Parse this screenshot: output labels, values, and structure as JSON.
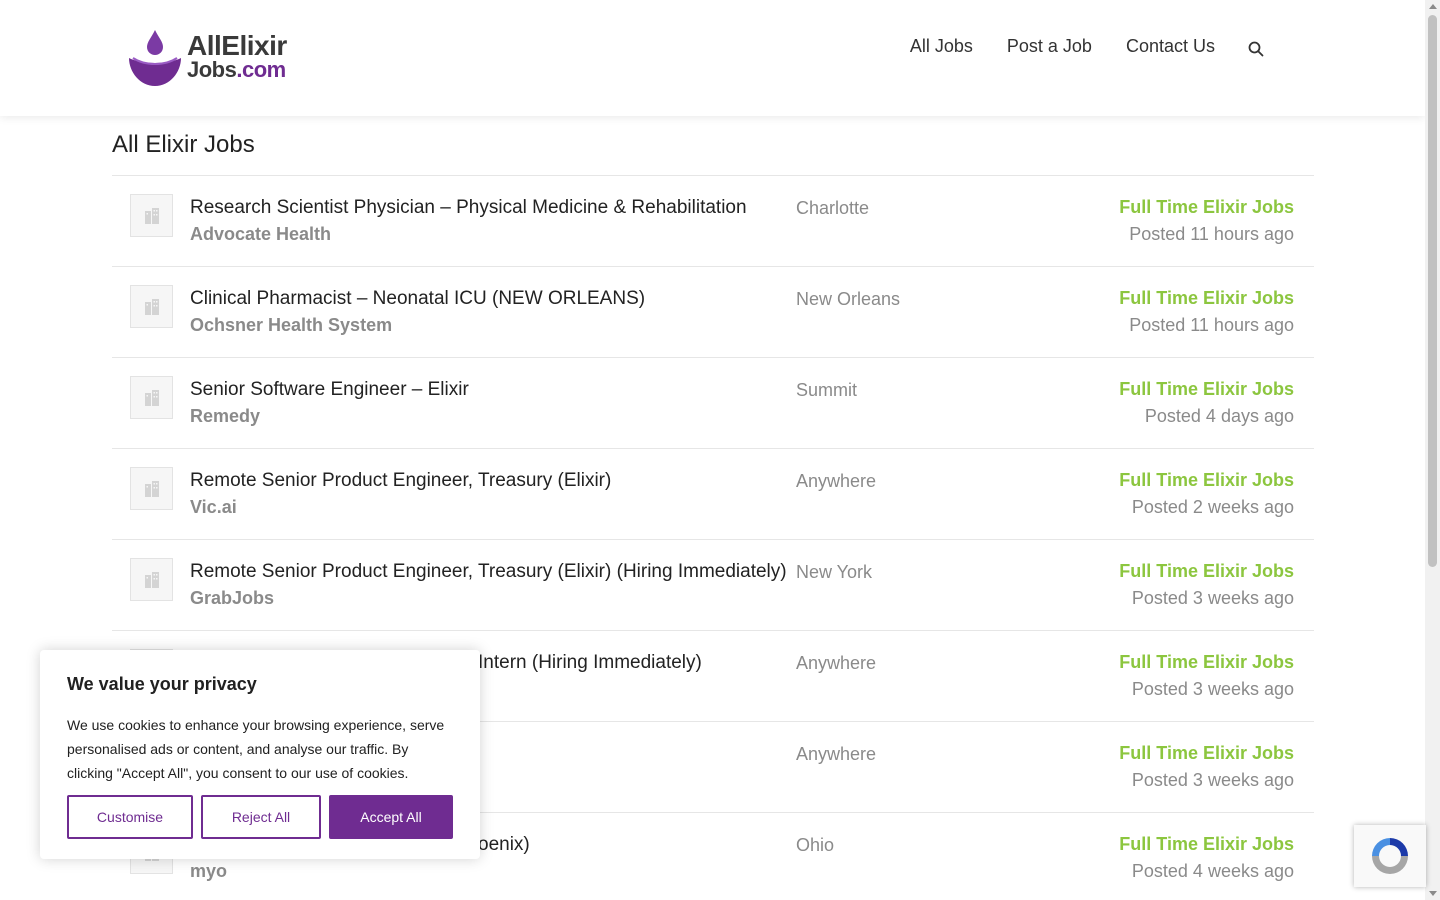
{
  "logo": {
    "line1": "AllElixir",
    "line2_main": "Jobs",
    "line2_suffix": ".com"
  },
  "nav": {
    "items": [
      "All Jobs",
      "Post a Job",
      "Contact Us"
    ],
    "search_icon": "search-icon"
  },
  "page": {
    "title": "All Elixir Jobs"
  },
  "jobs": [
    {
      "title": "Research Scientist Physician – Physical Medicine & Rehabilitation",
      "company": "Advocate Health",
      "location": "Charlotte",
      "type": "Full Time Elixir Jobs",
      "posted": "Posted 11 hours ago"
    },
    {
      "title": "Clinical Pharmacist – Neonatal ICU (NEW ORLEANS)",
      "company": "Ochsner Health System",
      "location": "New Orleans",
      "type": "Full Time Elixir Jobs",
      "posted": "Posted 11 hours ago"
    },
    {
      "title": "Senior Software Engineer – Elixir",
      "company": "Remedy",
      "location": "Summit",
      "type": "Full Time Elixir Jobs",
      "posted": "Posted 4 days ago"
    },
    {
      "title": "Remote Senior Product Engineer, Treasury (Elixir)",
      "company": "Vic.ai",
      "location": "Anywhere",
      "type": "Full Time Elixir Jobs",
      "posted": "Posted 2 weeks ago"
    },
    {
      "title": "Remote Senior Product Engineer, Treasury (Elixir) (Hiring Immediately)",
      "company": "GrabJobs",
      "location": "New York",
      "type": "Full Time Elixir Jobs",
      "posted": "Posted 3 weeks ago"
    },
    {
      "title": "Intern (Hiring Immediately)",
      "company": "",
      "location": "Anywhere",
      "type": "Full Time Elixir Jobs",
      "posted": "Posted 3 weeks ago"
    },
    {
      "title": "",
      "company": "",
      "location": "Anywhere",
      "type": "Full Time Elixir Jobs",
      "posted": "Posted 3 weeks ago"
    },
    {
      "title": "oenix)",
      "company": "myo",
      "location": "Ohio",
      "type": "Full Time Elixir Jobs",
      "posted": "Posted 4 weeks ago"
    }
  ],
  "cookie": {
    "title": "We value your privacy",
    "text": "We use cookies to enhance your browsing experience, serve personalised ads or content, and analyse our traffic. By clicking \"Accept All\", you consent to our use of cookies.",
    "customise": "Customise",
    "reject": "Reject All",
    "accept": "Accept All"
  },
  "colors": {
    "brand": "#6f2c91",
    "job_type": "#8cc63f",
    "muted": "#8a8a8a"
  }
}
